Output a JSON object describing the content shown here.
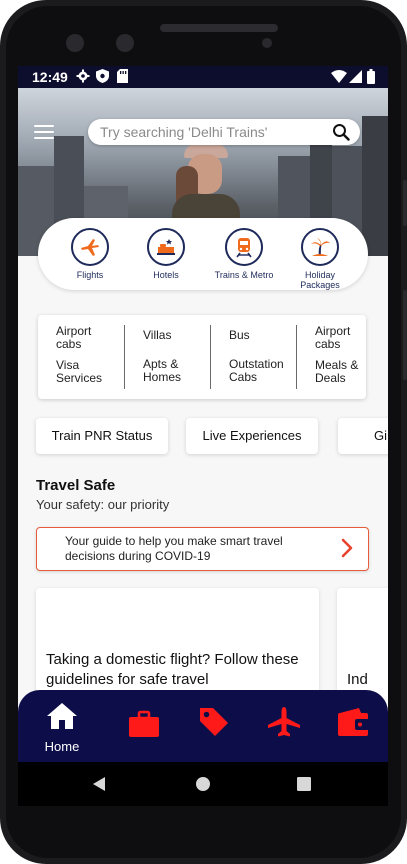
{
  "status_bar": {
    "time": "12:49"
  },
  "header": {
    "search_placeholder": "Try searching 'Delhi Trains'"
  },
  "categories": [
    {
      "icon": "plane-icon",
      "label": "Flights"
    },
    {
      "icon": "hotel-icon",
      "label": "Hotels"
    },
    {
      "icon": "train-icon",
      "label": "Trains & Metro"
    },
    {
      "icon": "palm-tree-icon",
      "label": "Holiday Packages"
    }
  ],
  "services": [
    [
      "Airport cabs",
      "Visa Services"
    ],
    [
      "Villas",
      "Apts & Homes"
    ],
    [
      "Bus",
      "Outstation Cabs"
    ],
    [
      "Airport cabs",
      "Meals & Deals"
    ]
  ],
  "quick_links": [
    "Train PNR Status",
    "Live Experiences",
    "Gi"
  ],
  "travel_safe": {
    "title": "Travel Safe",
    "subtitle": "Your safety: our priority",
    "guide_text": "Your guide to help you make smart travel decisions during COVID-19"
  },
  "articles": [
    {
      "title": "Taking a domestic flight? Follow these guidelines for safe travel"
    },
    {
      "title": "Ind"
    }
  ],
  "bottom_nav": [
    {
      "icon": "home-icon",
      "label": "Home"
    },
    {
      "icon": "briefcase-icon",
      "label": ""
    },
    {
      "icon": "tag-icon",
      "label": ""
    },
    {
      "icon": "plane-icon",
      "label": ""
    },
    {
      "icon": "wallet-icon",
      "label": ""
    }
  ],
  "colors": {
    "accent": "#e8432d",
    "navy": "#0d0d4a",
    "nav_red": "#ff1a1a"
  }
}
